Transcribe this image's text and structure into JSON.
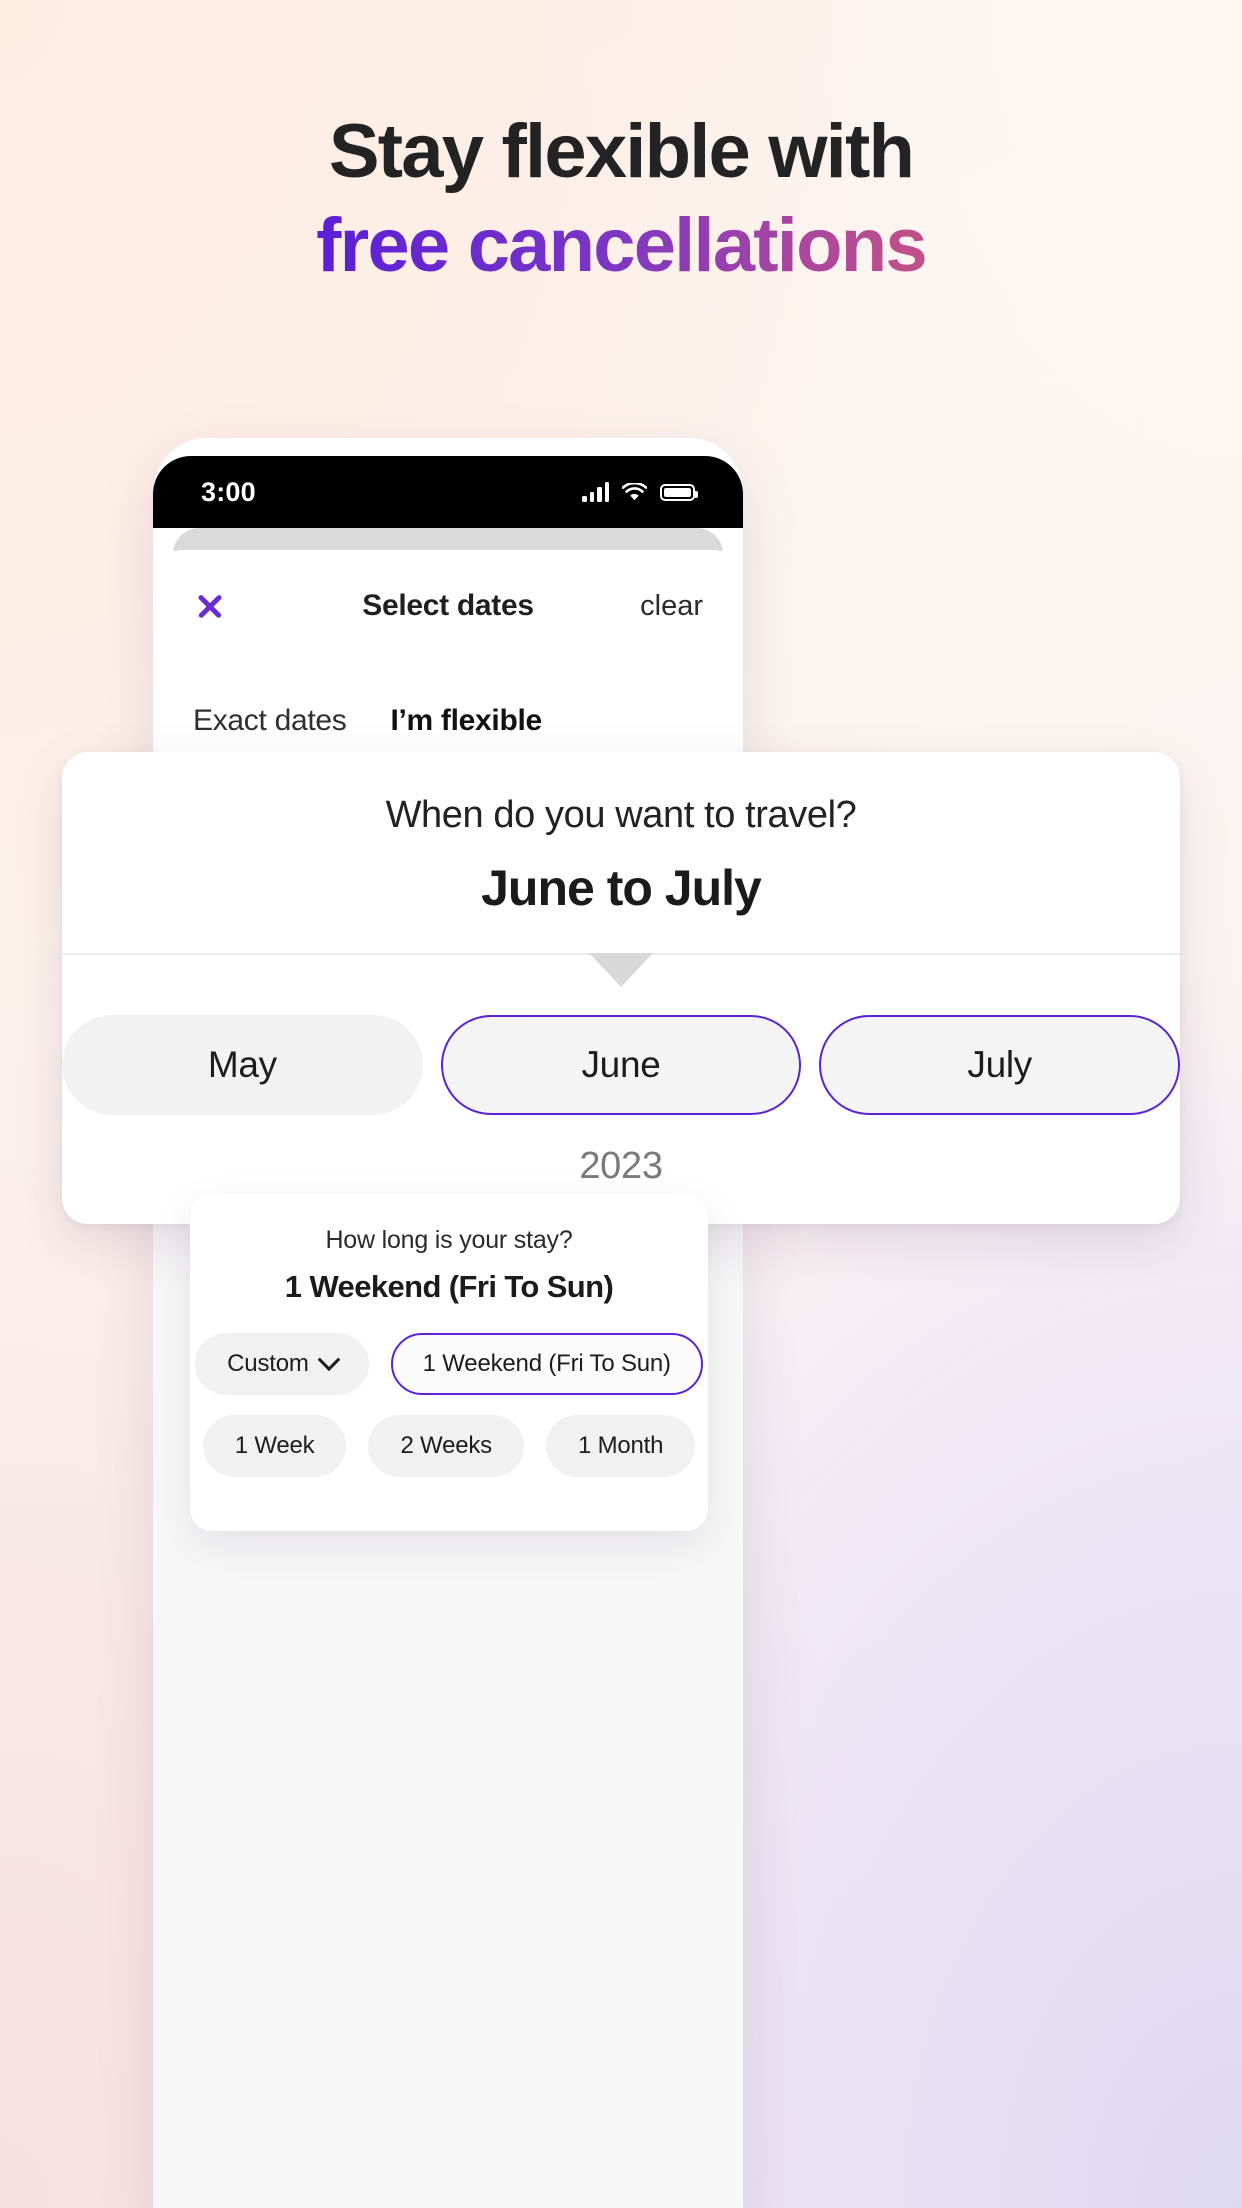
{
  "hero": {
    "line1": "Stay flexible with",
    "line2": "free cancellations",
    "gradient_start": "#5b1fd6",
    "gradient_end": "#e0655f"
  },
  "phone": {
    "status_bar": {
      "time": "3:00",
      "signal_icon": "cellular-signal-icon",
      "wifi_icon": "wifi-icon",
      "battery_icon": "battery-icon"
    },
    "sheet": {
      "close_icon": "close-icon",
      "title": "Select dates",
      "clear_label": "clear",
      "tabs": [
        {
          "label": "Exact dates",
          "active": false
        },
        {
          "label": "I’m flexible",
          "active": true
        }
      ],
      "accent_color": "#5b22d6"
    }
  },
  "travel_card": {
    "question": "When do you want to travel?",
    "answer": "June to July",
    "caret_icon": "caret-down-icon",
    "months": [
      {
        "label": "May",
        "selected": false
      },
      {
        "label": "June",
        "selected": true
      },
      {
        "label": "July",
        "selected": true
      }
    ],
    "year": "2023"
  },
  "stay_card": {
    "question": "How long is your stay?",
    "answer": "1 Weekend (Fri To Sun)",
    "options_row1": [
      {
        "label": "Custom",
        "selected": false,
        "has_chevron": true
      },
      {
        "label": "1 Weekend (Fri To Sun)",
        "selected": true,
        "has_chevron": false
      }
    ],
    "options_row2": [
      {
        "label": "1 Week",
        "selected": false
      },
      {
        "label": "2 Weeks",
        "selected": false
      },
      {
        "label": "1 Month",
        "selected": false
      }
    ]
  }
}
